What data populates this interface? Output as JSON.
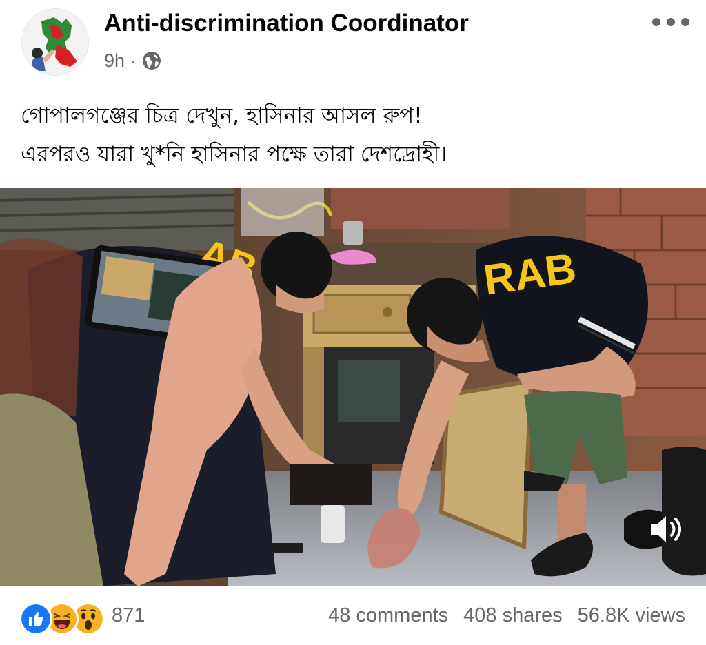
{
  "post": {
    "author": "Anti-discrimination Coordinator",
    "time": "9h",
    "separator": "·",
    "privacy_icon": "globe-icon",
    "more_icon": "more-options-icon",
    "caption_lines": [
      "গোপালগঞ্জের চিত্র দেখুন, হাসিনার আসল রুপ!",
      "এরপরও যারা খু*নি হাসিনার পক্ষে তারা দেশদ্রোহী।"
    ],
    "video_vest_text": "RAB",
    "sound_icon": "speaker-icon"
  },
  "footer": {
    "reaction_icons": [
      "like-icon",
      "haha-icon",
      "wow-icon"
    ],
    "reaction_count": "871",
    "comments": "48 comments",
    "shares": "408 shares",
    "views": "56.8K views"
  },
  "colors": {
    "author_text": "#050505",
    "secondary_text": "#65676b",
    "like_blue": "#1877f2",
    "emoji_yellow": "#f7b125",
    "vest_yellow": "#f5c518"
  }
}
